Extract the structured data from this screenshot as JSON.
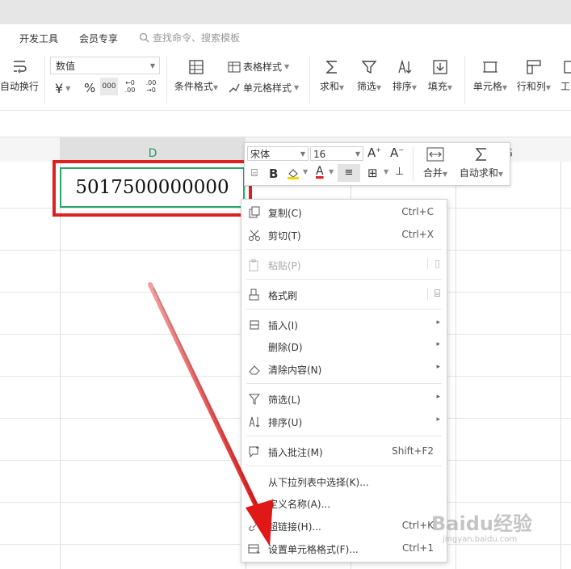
{
  "menubar": {
    "items": [
      "开发工具",
      "会员专享"
    ],
    "search_placeholder": "查找命令、搜索模板"
  },
  "ribbon": {
    "wrap_text": "自动换行",
    "number_format": "数值",
    "currency_symbol": "¥",
    "percent_symbol": "%",
    "thousands_symbol": "000",
    "decrease_decimal": "←0 .00",
    "increase_decimal": ".00 →0",
    "conditional_format": "条件格式",
    "table_style": "表格样式",
    "cell_style": "单元格样式",
    "sum": "求和",
    "filter": "筛选",
    "sort": "排序",
    "fill": "填充",
    "cell": "单元格",
    "rows_cols": "行和列",
    "work": "工"
  },
  "sheet": {
    "col_d": "D",
    "col_g": "G",
    "cell_value": "5017500000000"
  },
  "mini_toolbar": {
    "font": "宋体",
    "size": "16",
    "bold": "B",
    "font_color": "A",
    "merge": "合并",
    "autosum": "自动求和"
  },
  "context_menu": {
    "items": [
      {
        "label": "复制(C)",
        "shortcut": "Ctrl+C"
      },
      {
        "label": "剪切(T)",
        "shortcut": "Ctrl+X"
      },
      {
        "label": "粘贴(P)",
        "shortcut": ""
      },
      {
        "label": "格式刷",
        "shortcut": ""
      },
      {
        "label": "插入(I)",
        "shortcut": ""
      },
      {
        "label": "删除(D)",
        "shortcut": ""
      },
      {
        "label": "清除内容(N)",
        "shortcut": ""
      },
      {
        "label": "筛选(L)",
        "shortcut": ""
      },
      {
        "label": "排序(U)",
        "shortcut": ""
      },
      {
        "label": "插入批注(M)",
        "shortcut": "Shift+F2"
      },
      {
        "label": "从下拉列表中选择(K)...",
        "shortcut": ""
      },
      {
        "label": "定义名称(A)...",
        "shortcut": ""
      },
      {
        "label": "超链接(H)...",
        "shortcut": "Ctrl+K"
      },
      {
        "label": "设置单元格格式(F)...",
        "shortcut": "Ctrl+1"
      }
    ]
  },
  "watermark": {
    "logo": "Baidu经验",
    "url": "jingyan.baidu.com"
  },
  "colors": {
    "accent_green": "#2aa56d",
    "annotation_red": "#e02020"
  }
}
